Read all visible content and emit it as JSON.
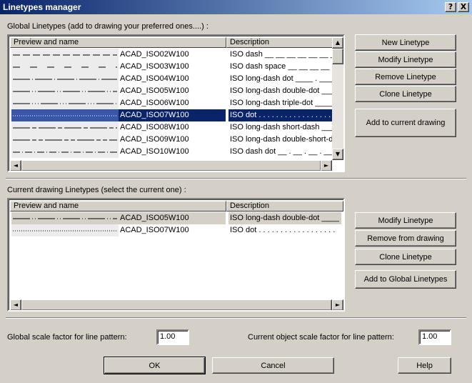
{
  "window": {
    "title": "Linetypes manager",
    "help_glyph": "?",
    "close_glyph": "X"
  },
  "global": {
    "label": "Global Linetypes (add to drawing your preferred ones....) :",
    "col_preview": "Preview and name",
    "col_desc": "Description",
    "rows": [
      {
        "name": "ACAD_ISO02W100",
        "desc": "ISO dash __ __ __ __ __ __ __ __",
        "dash": "10 4"
      },
      {
        "name": "ACAD_ISO03W100",
        "desc": "ISO dash space __    __    __    __",
        "dash": "10 14"
      },
      {
        "name": "ACAD_ISO04W100",
        "desc": "ISO long-dash dot ____ . ____ .",
        "dash": "24 3 1 3"
      },
      {
        "name": "ACAD_ISO05W100",
        "desc": "ISO long-dash double-dot ____ ..",
        "dash": "24 3 1 3 1 3"
      },
      {
        "name": "ACAD_ISO06W100",
        "desc": "ISO long-dash triple-dot ____ ...",
        "dash": "24 3 1 3 1 3 1 3"
      },
      {
        "name": "ACAD_ISO07W100",
        "desc": "ISO dot . . . . . . . . . . . . . . . . . .",
        "dash": "1 2"
      },
      {
        "name": "ACAD_ISO08W100",
        "desc": "ISO long-dash short-dash ____ __",
        "dash": "24 3 6 3"
      },
      {
        "name": "ACAD_ISO09W100",
        "desc": "ISO long-dash double-short-dash",
        "dash": "24 3 6 3 6 3"
      },
      {
        "name": "ACAD_ISO10W100",
        "desc": "ISO dash dot __ . __ . __ . __ .",
        "dash": "10 3 1 3"
      }
    ],
    "selected_index": 5,
    "buttons": {
      "new": "New Linetype",
      "modify": "Modify Linetype",
      "remove": "Remove Linetype",
      "clone": "Clone Linetype",
      "add_current": "Add to current drawing"
    }
  },
  "current": {
    "label": "Current drawing Linetypes (select the current one) :",
    "col_preview": "Preview and name",
    "col_desc": "Description",
    "rows": [
      {
        "name": "ACAD_ISO05W100",
        "desc": "ISO long-dash double-dot ____ ..",
        "dash": "24 3 1 3 1 3"
      },
      {
        "name": "ACAD_ISO07W100",
        "desc": "ISO dot . . . . . . . . . . . . . . . . . .",
        "dash": "1 2"
      }
    ],
    "buttons": {
      "modify": "Modify Linetype",
      "remove": "Remove from drawing",
      "clone": "Clone Linetype",
      "add_global": "Add to Global Linetypes"
    }
  },
  "scale": {
    "global_label": "Global scale factor for line pattern:",
    "global_value": "1.00",
    "object_label": "Current object scale factor for line pattern:",
    "object_value": "1.00"
  },
  "footer": {
    "ok": "OK",
    "cancel": "Cancel",
    "help": "Help"
  },
  "scroll": {
    "up": "▲",
    "down": "▼",
    "left": "◄",
    "right": "►"
  }
}
